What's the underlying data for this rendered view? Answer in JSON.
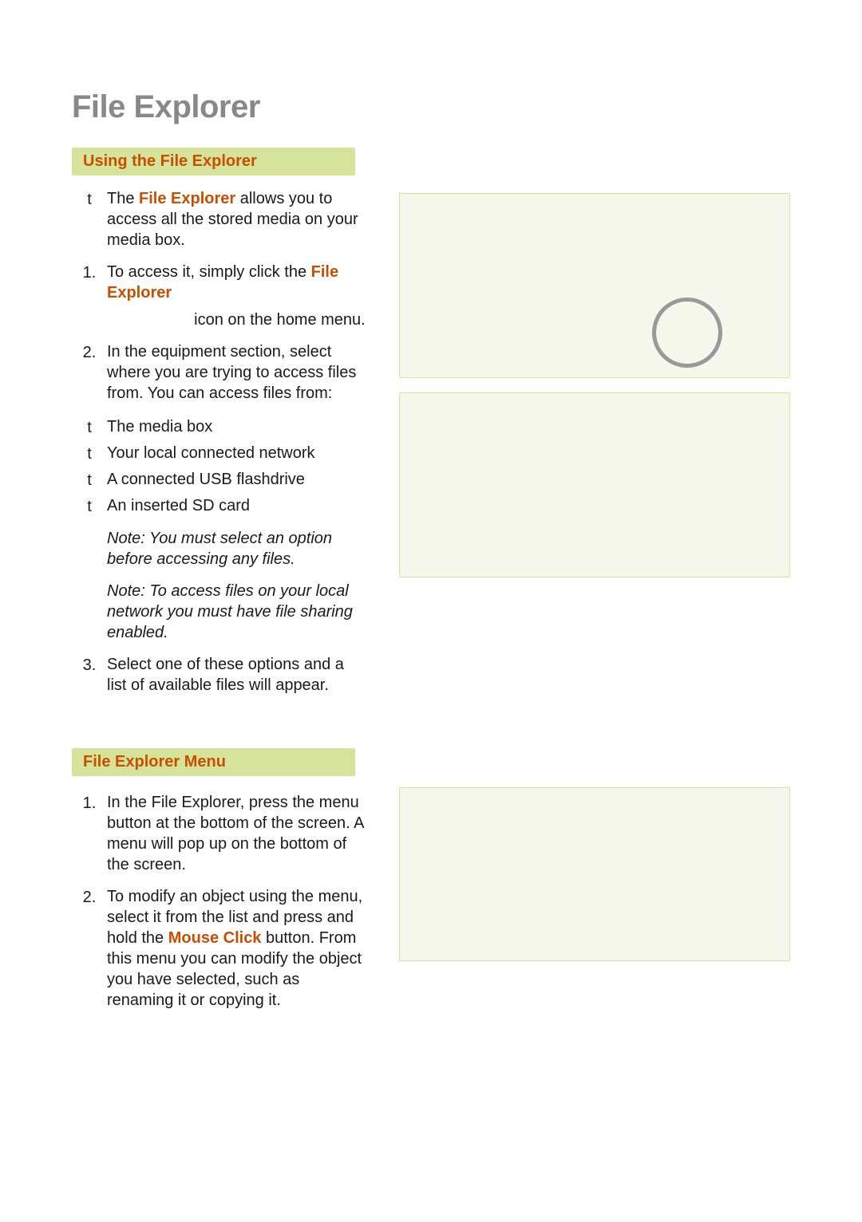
{
  "title": "File Explorer",
  "sections": {
    "using": {
      "heading": "Using the File Explorer",
      "intro_bullet": "t",
      "intro_prefix": "The ",
      "intro_emph": "File Explorer",
      "intro_suffix": " allows you to access all the stored media on your media box.",
      "steps": [
        {
          "num": "1.",
          "prefix": "To access it, simply click the ",
          "emph": "File Explorer",
          "suffix_line2": "icon on the home menu."
        },
        {
          "num": "2.",
          "text": "In the equipment section, select where you are trying to access files from. You can access files from:"
        }
      ],
      "sources_bullet": "t",
      "sources": [
        "The media box",
        "Your local connected network",
        "A connected USB flashdrive",
        "An inserted SD card"
      ],
      "notes": [
        "Note: You must select an option before accessing any files.",
        "Note: To access files on your local network you must have file sharing enabled."
      ],
      "step3": {
        "num": "3.",
        "text": "Select one of these options and a list of available files will appear."
      }
    },
    "menu": {
      "heading": "File Explorer Menu",
      "steps": [
        {
          "num": "1.",
          "text": "In the File Explorer, press the menu button at the bottom of the screen.  A menu will pop up on the bottom of the screen."
        },
        {
          "num": "2.",
          "prefix": "To modify an object using the menu, select it from the list and press and hold the ",
          "emph": "Mouse Click",
          "suffix": " button. From this menu you can modify the object you have selected, such as renaming it or copying it."
        }
      ]
    }
  }
}
